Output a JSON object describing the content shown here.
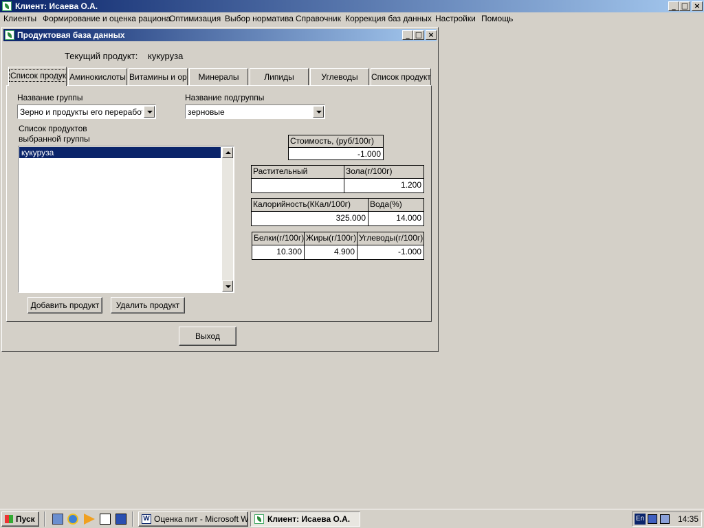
{
  "app": {
    "title": "Клиент: Исаева О.А.",
    "menu": [
      "Клиенты",
      "Формирование и оценка рациона",
      "Оптимизация",
      "Выбор норматива",
      "Справочник",
      "Коррекция  баз данных",
      "Настройки",
      "Помощь"
    ]
  },
  "dialog": {
    "title": "Продуктовая база данных",
    "current_product_label": "Текущий продукт:",
    "current_product_value": "кукуруза",
    "tabs": [
      "Список продуктов",
      "Аминокислоты",
      "Витамины и органические кислоты",
      "Минералы",
      "Липиды",
      "Углеводы",
      "Список продуктов"
    ],
    "group_label": "Название группы",
    "group_value": "Зерно и продукты его переработки",
    "subgroup_label": "Название подгруппы",
    "subgroup_value": "зерновые",
    "product_list_label_line1": "Список продуктов",
    "product_list_label_line2": "выбранной группы",
    "product_list": [
      "кукуруза"
    ],
    "cost": {
      "header": "Стоимость, (руб/100г)",
      "value": "-1.000"
    },
    "origin": {
      "header": "Растительный",
      "value": ""
    },
    "ash": {
      "header": "Зола(г/100г)",
      "value": "1.200"
    },
    "calories": {
      "header": "Калорийность(ККал/100г)",
      "value": "325.000"
    },
    "water": {
      "header": "Вода(%)",
      "value": "14.000"
    },
    "protein": {
      "header": "Белки(г/100г)",
      "value": "10.300"
    },
    "fat": {
      "header": "Жиры(г/100г)",
      "value": "4.900"
    },
    "carbs": {
      "header": "Углеводы(г/100г)",
      "value": "-1.000"
    },
    "add_button": "Добавить продукт",
    "delete_button": "Удалить продукт",
    "exit_button": "Выход"
  },
  "taskbar": {
    "start": "Пуск",
    "tasks": [
      "Оценка пит - Microsoft W...",
      "Клиент: Исаева О.А."
    ],
    "lang": "En",
    "clock": "14:35"
  }
}
